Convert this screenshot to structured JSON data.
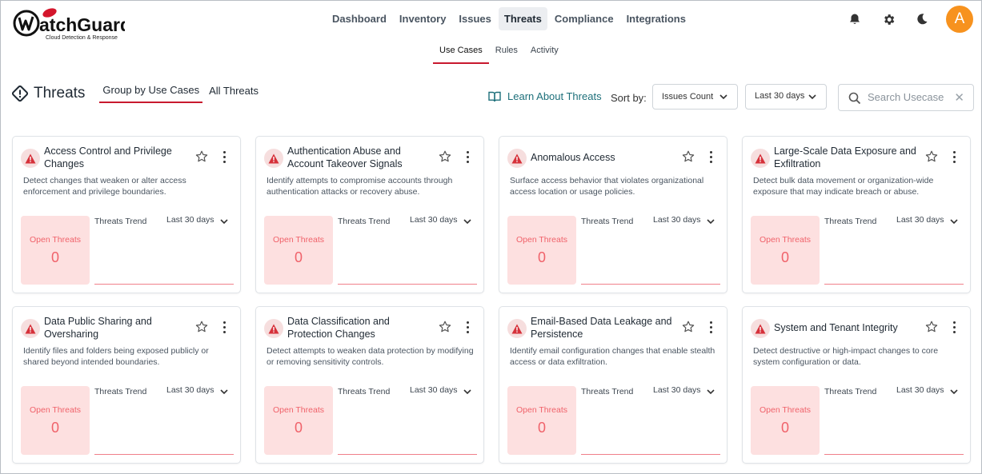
{
  "brand": {
    "name": "WatchGuard",
    "tagline": "Cloud Detection & Response"
  },
  "nav": {
    "items": [
      {
        "label": "Dashboard"
      },
      {
        "label": "Inventory"
      },
      {
        "label": "Issues"
      },
      {
        "label": "Threats",
        "active": true
      },
      {
        "label": "Compliance"
      },
      {
        "label": "Integrations"
      }
    ]
  },
  "subnav": {
    "items": [
      {
        "label": "Use Cases",
        "active": true
      },
      {
        "label": "Rules"
      },
      {
        "label": "Activity"
      }
    ]
  },
  "user": {
    "initial": "A",
    "avatar_color": "#f7921e"
  },
  "header": {
    "title": "Threats",
    "tabs": [
      {
        "label": "Group by Use Cases",
        "active": true
      },
      {
        "label": "All Threats"
      }
    ],
    "learn_link": "Learn About Threats",
    "sort_label": "Sort by:",
    "sort_value": "Issues Count",
    "range_value": "Last 30 days",
    "search_placeholder": "Search Usecase"
  },
  "colors": {
    "accent": "#c8192e",
    "teal": "#1d6f7a",
    "open_bg": "#fde0e0",
    "open_text": "#f0626a"
  },
  "cards": [
    {
      "title": "Access Control and Privilege Changes",
      "description": "Detect changes that weaken or alter access enforcement and privilege boundaries.",
      "open_label": "Open Threats",
      "open_count": "0",
      "trend_label": "Threats Trend",
      "trend_range": "Last 30 days"
    },
    {
      "title": "Authentication Abuse and Account Takeover Signals",
      "description": "Identify attempts to compromise accounts through authentication attacks or recovery abuse.",
      "open_label": "Open Threats",
      "open_count": "0",
      "trend_label": "Threats Trend",
      "trend_range": "Last 30 days"
    },
    {
      "title": "Anomalous Access",
      "description": "Surface access behavior that violates organizational access location or usage policies.",
      "open_label": "Open Threats",
      "open_count": "0",
      "trend_label": "Threats Trend",
      "trend_range": "Last 30 days"
    },
    {
      "title": "Large-Scale Data Exposure and Exfiltration",
      "description": "Detect bulk data movement or organization-wide exposure that may indicate breach or abuse.",
      "open_label": "Open Threats",
      "open_count": "0",
      "trend_label": "Threats Trend",
      "trend_range": "Last 30 days"
    },
    {
      "title": "Data Public Sharing and Oversharing",
      "description": "Identify files and folders being exposed publicly or shared beyond intended boundaries.",
      "open_label": "Open Threats",
      "open_count": "0",
      "trend_label": "Threats Trend",
      "trend_range": "Last 30 days"
    },
    {
      "title": "Data Classification and Protection Changes",
      "description": "Detect attempts to weaken data protection by modifying or removing sensitivity controls.",
      "open_label": "Open Threats",
      "open_count": "0",
      "trend_label": "Threats Trend",
      "trend_range": "Last 30 days"
    },
    {
      "title": "Email-Based Data Leakage and Persistence",
      "description": "Identify email configuration changes that enable stealth access or data exfiltration.",
      "open_label": "Open Threats",
      "open_count": "0",
      "trend_label": "Threats Trend",
      "trend_range": "Last 30 days"
    },
    {
      "title": "System and Tenant Integrity",
      "description": "Detect destructive or high-impact changes to core system configuration or data.",
      "open_label": "Open Threats",
      "open_count": "0",
      "trend_label": "Threats Trend",
      "trend_range": "Last 30 days"
    }
  ]
}
